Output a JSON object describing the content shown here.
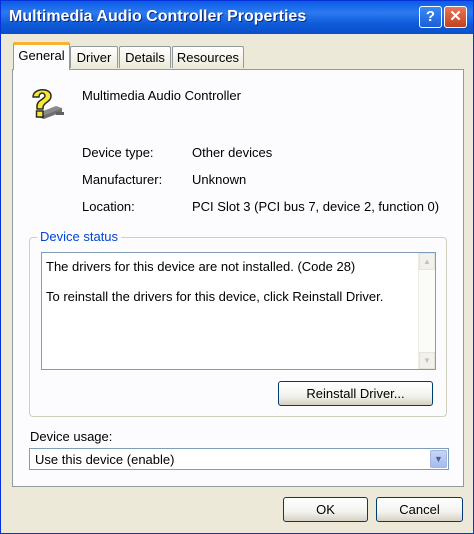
{
  "window": {
    "title": "Multimedia Audio Controller Properties"
  },
  "titlebar": {
    "help_glyph": "?",
    "close_glyph": "✕"
  },
  "tabs": [
    {
      "label": "General",
      "active": true
    },
    {
      "label": "Driver",
      "active": false
    },
    {
      "label": "Details",
      "active": false
    },
    {
      "label": "Resources",
      "active": false
    }
  ],
  "device": {
    "icon": "unknown-device-question-mark-icon",
    "name": "Multimedia Audio Controller",
    "properties": [
      {
        "label": "Device type:",
        "value": "Other devices"
      },
      {
        "label": "Manufacturer:",
        "value": "Unknown"
      },
      {
        "label": "Location:",
        "value": "PCI Slot 3 (PCI bus 7, device 2, function 0)"
      }
    ]
  },
  "status": {
    "legend": "Device status",
    "lines": [
      "The drivers for this device are not installed. (Code 28)",
      "To reinstall the drivers for this device, click Reinstall Driver."
    ],
    "button_label": "Reinstall Driver..."
  },
  "usage": {
    "label": "Device usage:",
    "selected": "Use this device (enable)"
  },
  "footer": {
    "ok_label": "OK",
    "cancel_label": "Cancel"
  },
  "colors": {
    "title_bar": "#0a5ce6",
    "dialog_bg": "#ece9d8",
    "legend_text": "#0046d5",
    "active_tab_accent": "#f5b32f"
  }
}
